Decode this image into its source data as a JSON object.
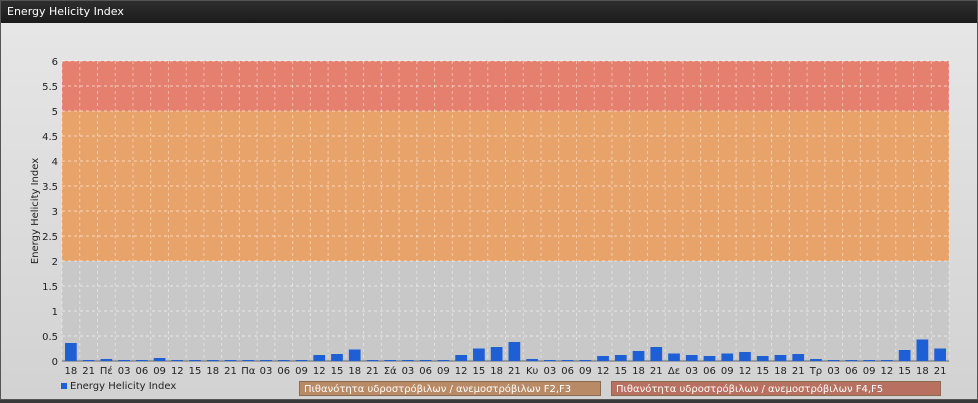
{
  "window": {
    "title": "Energy Helicity Index"
  },
  "chart_data": {
    "type": "bar",
    "ylabel": "Energy Helicity Index",
    "xlabel": "",
    "ylim": [
      0,
      6
    ],
    "yticks": [
      "0",
      "0.5",
      "1",
      "1.5",
      "2",
      "2.5",
      "3",
      "3.5",
      "4",
      "4.5",
      "5",
      "5.5",
      "6"
    ],
    "grid": true,
    "categories": [
      "18",
      "21",
      "Πέ",
      "03",
      "06",
      "09",
      "12",
      "15",
      "18",
      "21",
      "Πα",
      "03",
      "06",
      "09",
      "12",
      "15",
      "18",
      "21",
      "Σά",
      "03",
      "06",
      "09",
      "12",
      "15",
      "18",
      "21",
      "Κυ",
      "03",
      "06",
      "09",
      "12",
      "15",
      "18",
      "21",
      "Δε",
      "03",
      "06",
      "09",
      "12",
      "15",
      "18",
      "21",
      "Τρ",
      "03",
      "06",
      "09",
      "12",
      "15",
      "18",
      "21"
    ],
    "series": [
      {
        "name": "Energy Helicity Index",
        "values": [
          0.36,
          0.02,
          0.04,
          0.02,
          0.02,
          0.06,
          0.02,
          0.02,
          0.02,
          0.02,
          0.02,
          0.02,
          0.02,
          0.02,
          0.12,
          0.14,
          0.23,
          0.02,
          0.02,
          0.02,
          0.02,
          0.02,
          0.12,
          0.25,
          0.28,
          0.38,
          0.04,
          0.02,
          0.02,
          0.02,
          0.1,
          0.12,
          0.2,
          0.28,
          0.15,
          0.12,
          0.1,
          0.15,
          0.18,
          0.1,
          0.12,
          0.14,
          0.04,
          0.02,
          0.02,
          0.02,
          0.02,
          0.22,
          0.43,
          0.25
        ]
      }
    ],
    "bands": [
      {
        "from": 0,
        "to": 2,
        "color": "#c8c8c8"
      },
      {
        "from": 2,
        "to": 5,
        "color": "#e8a36a"
      },
      {
        "from": 5,
        "to": 6,
        "color": "#e5806e"
      }
    ],
    "legend": {
      "series_label": "Energy Helicity Index",
      "band_label_1": "Πιθανότητα υδροστρόβιλων / ανεμοστρόβιλων F2,F3",
      "band_label_2": "Πιθανότητα υδροστρόβιλων / ανεμοστρόβιλων F4,F5"
    },
    "colors": {
      "bar": "#1f5fd6",
      "band_legend_1": "#c8916a",
      "band_legend_2": "#c8785a"
    }
  }
}
